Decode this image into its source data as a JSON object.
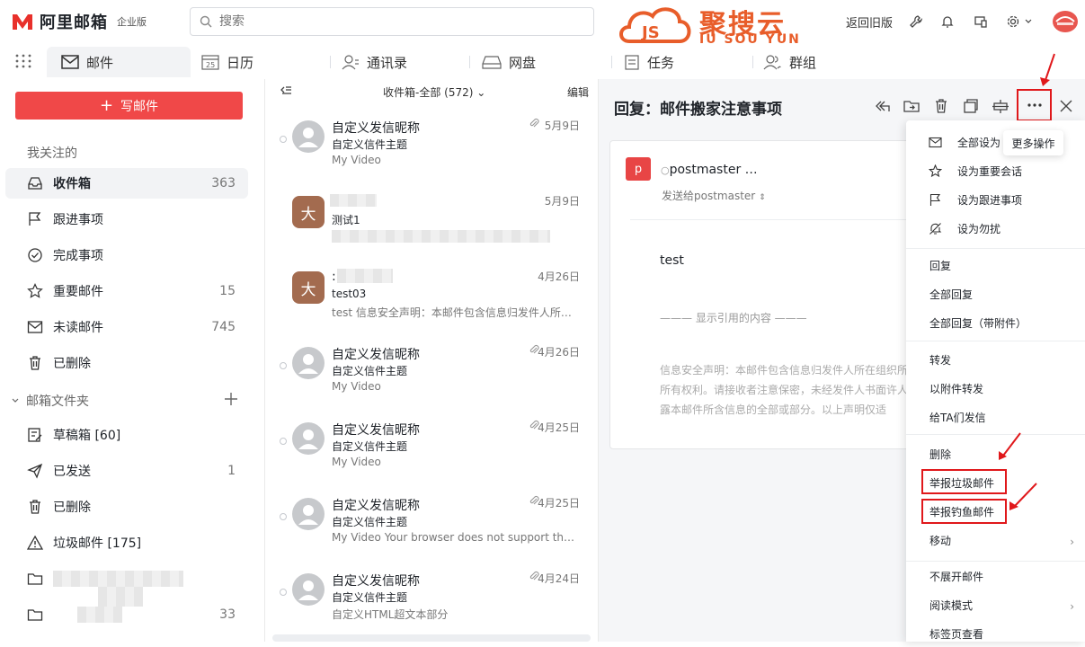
{
  "app": {
    "brand": "阿里邮箱",
    "edition": "企业版",
    "search_placeholder": "搜索",
    "watermark_cn": "聚搜云",
    "watermark_en": "JU SOU YUN",
    "old_version": "返回旧版"
  },
  "nav": {
    "tabs": [
      {
        "label": "邮件",
        "icon": "mail-icon"
      },
      {
        "label": "日历",
        "icon": "calendar-icon",
        "day": "25"
      },
      {
        "label": "通讯录",
        "icon": "contacts-icon"
      },
      {
        "label": "网盘",
        "icon": "drive-icon"
      },
      {
        "label": "任务",
        "icon": "task-icon"
      },
      {
        "label": "群组",
        "icon": "group-icon"
      }
    ]
  },
  "sidebar": {
    "compose": "写邮件",
    "favorites_title": "我关注的",
    "favorites": [
      {
        "label": "收件箱",
        "count": "363",
        "icon": "inbox-icon"
      },
      {
        "label": "跟进事项",
        "count": "",
        "icon": "flag-icon"
      },
      {
        "label": "完成事项",
        "count": "",
        "icon": "check-circle-icon"
      },
      {
        "label": "重要邮件",
        "count": "15",
        "icon": "star-icon"
      },
      {
        "label": "未读邮件",
        "count": "745",
        "icon": "envelope-icon"
      },
      {
        "label": "已删除",
        "count": "",
        "icon": "trash-icon"
      }
    ],
    "folders_title": "邮箱文件夹",
    "folders": [
      {
        "label": "草稿箱 [60]",
        "count": "",
        "icon": "draft-icon"
      },
      {
        "label": "已发送",
        "count": "1",
        "icon": "send-icon"
      },
      {
        "label": "已删除",
        "count": "",
        "icon": "trash-icon"
      },
      {
        "label": "垃圾邮件 [175]",
        "count": "",
        "icon": "warning-icon"
      },
      {
        "label": "",
        "count": "",
        "icon": "folder-icon"
      },
      {
        "label": "",
        "count": "33",
        "icon": "folder-icon"
      }
    ]
  },
  "list": {
    "folder": "收件箱-全部 (572)",
    "edit": "编辑",
    "items": [
      {
        "sender": "自定义发信昵称",
        "subject": "自定义信件主题",
        "preview": "My Video",
        "date": "5月9日",
        "avatar": "",
        "attach": true
      },
      {
        "sender": "",
        "subject": "测试1",
        "preview": "",
        "date": "5月9日",
        "avatar": "大",
        "attach": false
      },
      {
        "sender": ":",
        "subject": "test03",
        "preview": "test 信息安全声明：本邮件包含信息归发件人所…",
        "date": "4月26日",
        "avatar": "大",
        "attach": false
      },
      {
        "sender": "自定义发信昵称",
        "subject": "自定义信件主题",
        "preview": "My Video",
        "date": "4月26日",
        "avatar": "",
        "attach": true
      },
      {
        "sender": "自定义发信昵称",
        "subject": "自定义信件主题",
        "preview": "My Video",
        "date": "4月25日",
        "avatar": "",
        "attach": true
      },
      {
        "sender": "自定义发信昵称",
        "subject": "自定义信件主题",
        "preview": "My Video Your browser does not support the vid…",
        "date": "4月25日",
        "avatar": "",
        "attach": true
      },
      {
        "sender": "自定义发信昵称",
        "subject": "自定义信件主题",
        "preview": "自定义HTML超文本部分",
        "date": "4月24日",
        "avatar": "",
        "attach": true
      }
    ]
  },
  "reader": {
    "title": "回复：邮件搬家注意事项",
    "from": "postmaster …",
    "avatar": "p",
    "to": "发送给postmaster",
    "body": "test",
    "quote": "——— 显示引用的内容 ———",
    "disclaimer": "信息安全声明：本邮件包含信息归发件人所在组织所有所有权利。请接收者注意保密，未经发件人书面许人透露本邮件所含信息的全部或部分。以上声明仅适",
    "tooltip": "更多操作"
  },
  "menu": {
    "items": [
      {
        "label": "全部设为",
        "icon": "envelope-icon",
        "group": 1
      },
      {
        "label": "设为重要会话",
        "icon": "star-icon",
        "group": 1
      },
      {
        "label": "设为跟进事项",
        "icon": "flag-icon",
        "group": 1
      },
      {
        "label": "设为勿扰",
        "icon": "bell-off-icon",
        "group": 1
      },
      {
        "label": "回复",
        "group": 2
      },
      {
        "label": "全部回复",
        "group": 2
      },
      {
        "label": "全部回复（带附件）",
        "group": 2
      },
      {
        "label": "转发",
        "group": 3
      },
      {
        "label": "以附件转发",
        "group": 3
      },
      {
        "label": "给TA们发信",
        "group": 3
      },
      {
        "label": "删除",
        "group": 4
      },
      {
        "label": "举报垃圾邮件",
        "group": 4,
        "highlight": true
      },
      {
        "label": "举报钓鱼邮件",
        "group": 4,
        "highlight": true
      },
      {
        "label": "移动",
        "group": 4,
        "submenu": true
      },
      {
        "label": "不展开邮件",
        "group": 5
      },
      {
        "label": "阅读模式",
        "group": 5,
        "submenu": true
      },
      {
        "label": "标签页查看",
        "group": 5
      }
    ]
  },
  "colors": {
    "accent": "#f04848",
    "annotation": "#e0181b",
    "watermark": "#e85d2a"
  }
}
